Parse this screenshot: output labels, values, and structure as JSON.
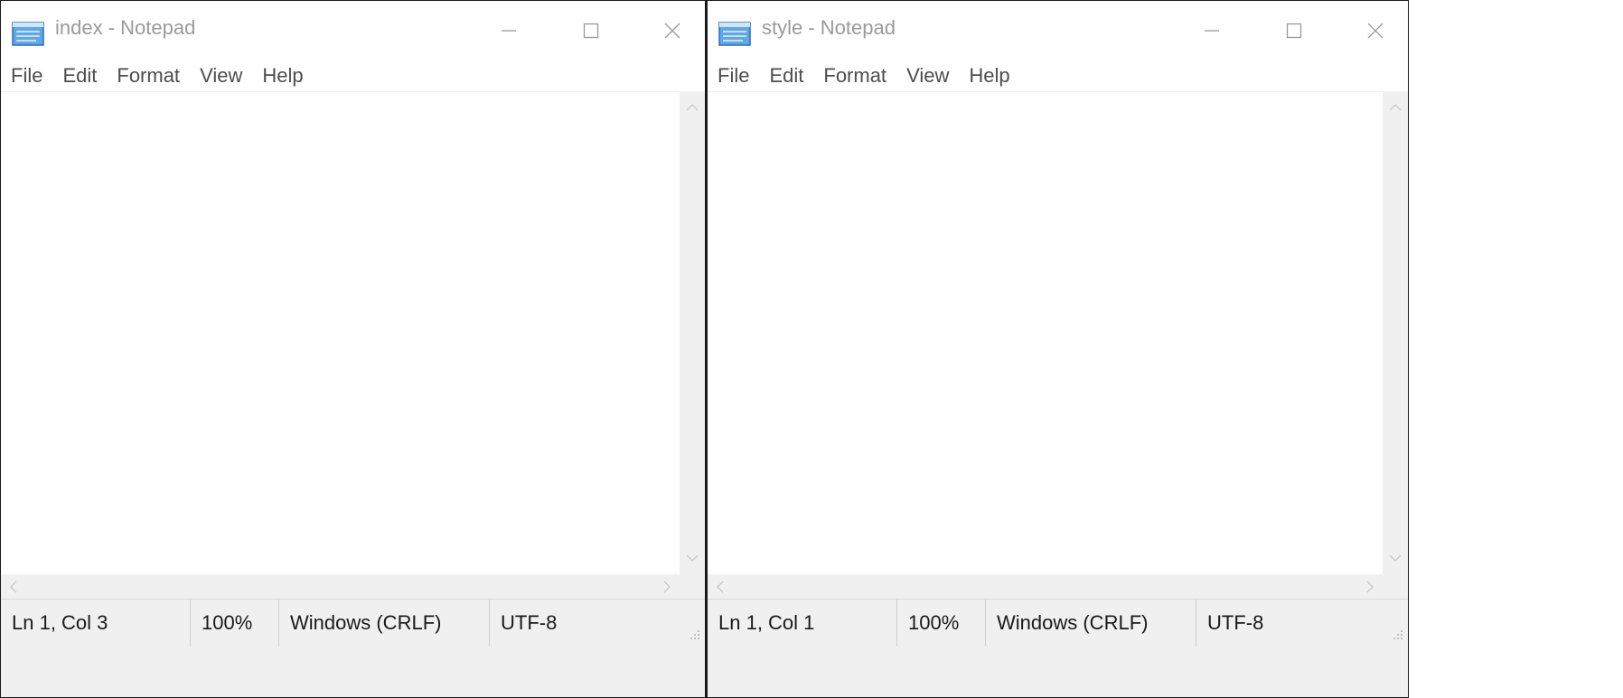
{
  "windows": [
    {
      "title": "index - Notepad",
      "menu": [
        "File",
        "Edit",
        "Format",
        "View",
        "Help"
      ],
      "status": {
        "position": "Ln 1, Col 3",
        "zoom": "100%",
        "line_ending": "Windows (CRLF)",
        "encoding": "UTF-8"
      }
    },
    {
      "title": "style - Notepad",
      "menu": [
        "File",
        "Edit",
        "Format",
        "View",
        "Help"
      ],
      "status": {
        "position": "Ln 1, Col 1",
        "zoom": "100%",
        "line_ending": "Windows (CRLF)",
        "encoding": "UTF-8"
      }
    }
  ],
  "icons": {
    "app": "notepad-icon",
    "minimize": "minimize-icon",
    "maximize": "maximize-icon",
    "close": "close-icon"
  },
  "colors": {
    "title_text": "#9a9a9a",
    "status_bar": "#f0f0f0",
    "scrollbar": "#f0f0f0",
    "icon_blue": "#5fa8e8"
  }
}
